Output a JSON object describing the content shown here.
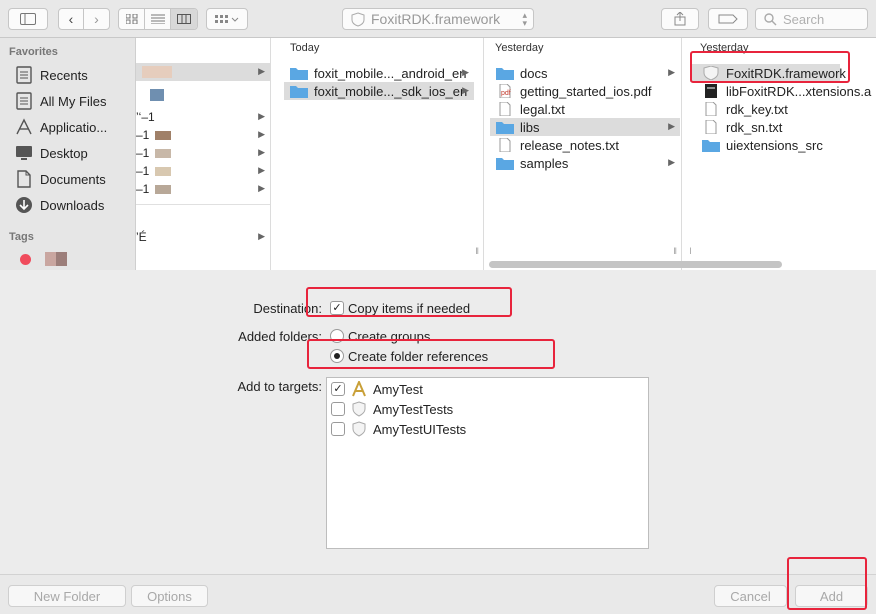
{
  "toolbar": {
    "path_label": "FoxitRDK.framework",
    "search_placeholder": "Search"
  },
  "sidebar": {
    "favorites_header": "Favorites",
    "items": [
      {
        "label": "Recents",
        "icon": "recents-icon"
      },
      {
        "label": "All My Files",
        "icon": "all-files-icon"
      },
      {
        "label": "Applicatio...",
        "icon": "applications-icon"
      },
      {
        "label": "Desktop",
        "icon": "desktop-icon"
      },
      {
        "label": "Documents",
        "icon": "documents-icon"
      },
      {
        "label": "Downloads",
        "icon": "downloads-icon"
      }
    ],
    "tags_header": "Tags",
    "tag_color": "#f04b5c"
  },
  "columns": {
    "col1": {
      "rows": [
        "",
        "",
        "’‘–1",
        "–1",
        "–1",
        "–1",
        "–1",
        "’É"
      ]
    },
    "col2": {
      "header": "Today",
      "rows": [
        "foxit_mobile..._android_en",
        "foxit_mobile..._sdk_ios_en"
      ]
    },
    "col3": {
      "header": "Yesterday",
      "rows": [
        "docs",
        "getting_started_ios.pdf",
        "legal.txt",
        "libs",
        "release_notes.txt",
        "samples"
      ]
    },
    "col4": {
      "header": "Yesterday",
      "rows": [
        "FoxitRDK.framework",
        "libFoxitRDK...xtensions.a",
        "rdk_key.txt",
        "rdk_sn.txt",
        "uiextensions_src"
      ]
    }
  },
  "options": {
    "destination_label": "Destination:",
    "copy_items_label": "Copy items if needed",
    "copy_items_checked": true,
    "added_folders_label": "Added folders:",
    "create_groups_label": "Create groups",
    "create_folder_refs_label": "Create folder references",
    "selected_folder_option": "Create folder references",
    "add_to_targets_label": "Add to targets:",
    "targets": [
      {
        "name": "AmyTest",
        "checked": true
      },
      {
        "name": "AmyTestTests",
        "checked": false
      },
      {
        "name": "AmyTestUITests",
        "checked": false
      }
    ]
  },
  "buttons": {
    "new_folder": "New Folder",
    "options": "Options",
    "cancel": "Cancel",
    "add": "Add"
  },
  "colors": {
    "highlight": "#e8243c",
    "folder_blue": "#5aa7e3",
    "selection_gray": "#dcdcdc"
  }
}
